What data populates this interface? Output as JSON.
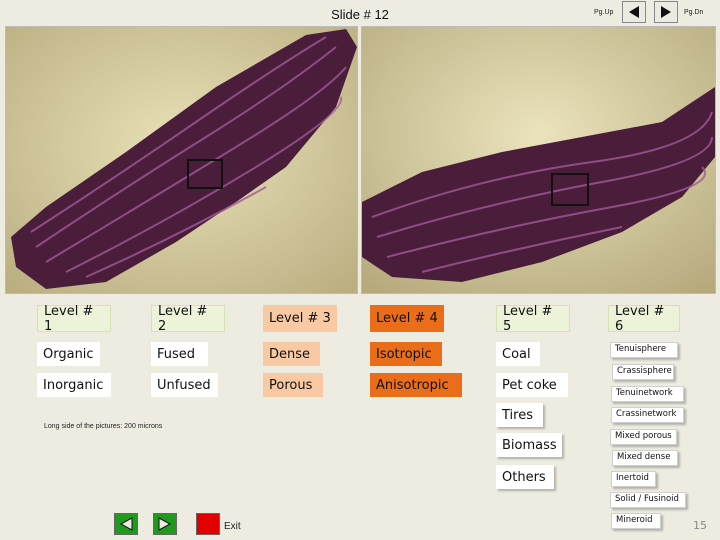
{
  "slide": {
    "title": "Slide # 12",
    "page_number": "15"
  },
  "nav": {
    "pg_up": "Pg.Up",
    "pg_dn": "Pg.Dn",
    "exit": "Exit"
  },
  "levels": {
    "l1": {
      "title": "Level # 1",
      "items": [
        "Organic",
        "Inorganic"
      ]
    },
    "l2": {
      "title": "Level # 2",
      "items": [
        "Fused",
        "Unfused"
      ]
    },
    "l3": {
      "title": "Level # 3",
      "items": [
        "Dense",
        "Porous"
      ]
    },
    "l4": {
      "title": "Level # 4",
      "items": [
        "Isotropic",
        "Anisotropic"
      ]
    },
    "l5": {
      "title": "Level # 5",
      "items": [
        "Coal",
        "Pet coke",
        "Tires",
        "Biomass",
        "Others"
      ]
    },
    "l6": {
      "title": "Level # 6",
      "items": [
        "Tenuisphere",
        "Crassisphere",
        "Tenuinetwork",
        "Crassinetwork",
        "Mixed porous",
        "Mixed dense",
        "Inertoid",
        "Solid / Fusinoid",
        "Mineroid"
      ]
    }
  },
  "note": "Long side of the pictures: 200 microns",
  "colors": {
    "level4_accent": "#ea6d1a",
    "level3_fill": "#f8c9a2",
    "nav_arrow": "#1f9a1f",
    "stop": "#e00000"
  }
}
